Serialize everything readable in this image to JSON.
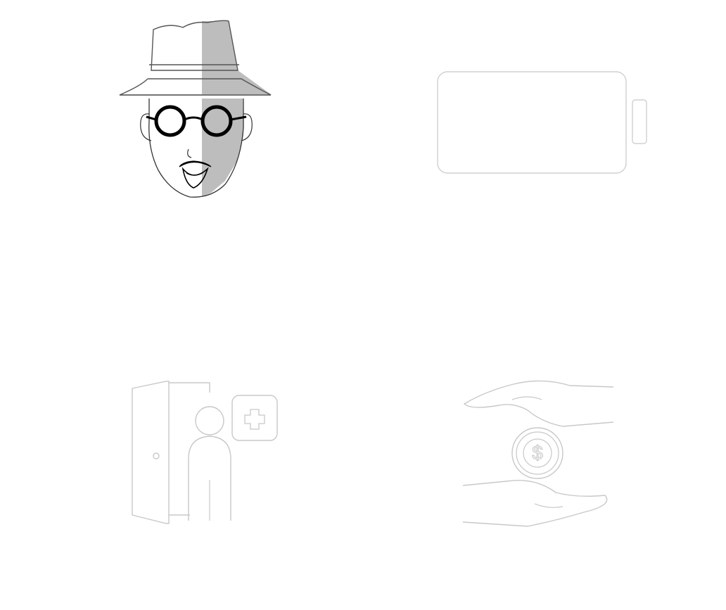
{
  "icons": [
    {
      "id": "detective",
      "name": "detective-face-icon",
      "style": "filled-outline",
      "stroke": "#000000",
      "shade": "#bdbdbd"
    },
    {
      "id": "battery",
      "name": "empty-battery-icon",
      "style": "thin-outline",
      "stroke": "#d0d0d0"
    },
    {
      "id": "doctor",
      "name": "person-at-door-medical-icon",
      "style": "thin-outline",
      "stroke": "#c8c8c8"
    },
    {
      "id": "money",
      "name": "hands-protecting-dollar-coin-icon",
      "style": "thin-outline",
      "stroke": "#c8c8c8"
    }
  ],
  "colors": {
    "background": "#ffffff",
    "dark_stroke": "#000000",
    "light_stroke": "#c8c8c8",
    "shade": "#bdbdbd"
  }
}
